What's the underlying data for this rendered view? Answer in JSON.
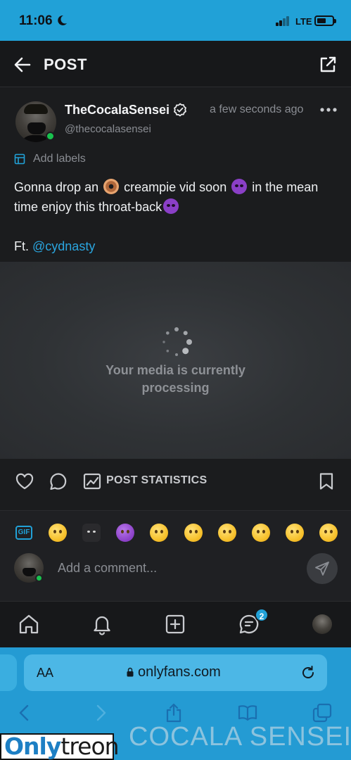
{
  "status_bar": {
    "time": "11:06",
    "network": "LTE"
  },
  "header": {
    "title": "POST"
  },
  "post": {
    "author_name": "TheCocalaSensei",
    "author_handle": "@thecocalasensei",
    "time_ago": "a few seconds ago",
    "add_labels": "Add labels",
    "text_part1": "Gonna drop an",
    "text_part2": "creampie vid soon",
    "text_part3": "in the mean time enjoy this throat-back",
    "text_ft": "Ft.",
    "mention": "@cydnasty",
    "emoji_icons": [
      "donut-emoji",
      "smiling-devil-emoji"
    ]
  },
  "media": {
    "status_line1": "Your media is currently",
    "status_line2": "processing"
  },
  "actions": {
    "statistics_label": "POST STATISTICS"
  },
  "reactions": {
    "gif_label": "GIF",
    "emojis": [
      "relieved-face",
      "ninja",
      "smiling-devil",
      "grinning-face",
      "beaming-face",
      "tears-of-joy",
      "grinning-big-eyes",
      "grinning-smiling-eyes",
      "grinning-sweat"
    ]
  },
  "comment": {
    "placeholder": "Add a comment..."
  },
  "bottom_nav": {
    "messages_badge": "2",
    "items": [
      "home-icon",
      "notifications-icon",
      "add-post-icon",
      "messages-icon",
      "profile-avatar"
    ]
  },
  "browser": {
    "text_size_label": "AA",
    "url": "onlyfans.com"
  },
  "watermark": {
    "logo_part1": "Only",
    "logo_part2": "treon",
    "overlay_text": "COCALA SENSEI"
  },
  "colors": {
    "accent": "#21a1d7",
    "online": "#19c24e",
    "background": "#1b1c1e"
  }
}
